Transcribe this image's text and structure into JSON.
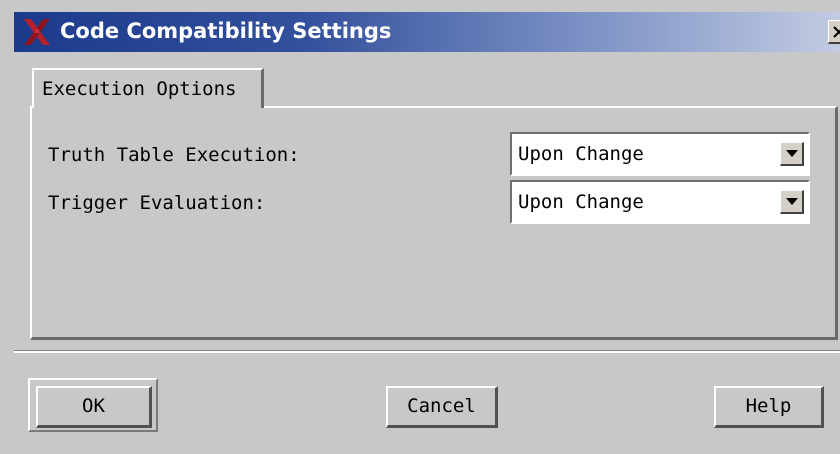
{
  "window": {
    "title": "Code Compatibility Settings",
    "app_icon": "x-logo-icon",
    "close_icon": "close-icon"
  },
  "tabs": [
    {
      "label": "Execution Options",
      "selected": true
    }
  ],
  "fields": [
    {
      "label": "Truth Table Execution:",
      "value": "Upon Change"
    },
    {
      "label": "Trigger Evaluation:",
      "value": "Upon Change"
    }
  ],
  "buttons": {
    "ok": "OK",
    "cancel": "Cancel",
    "help": "Help"
  },
  "colors": {
    "title_bar_start": "#1c3a8c",
    "title_bar_end": "#c2cbe2",
    "window_bg": "#c8c8c8",
    "x_logo": "#b8202a"
  }
}
